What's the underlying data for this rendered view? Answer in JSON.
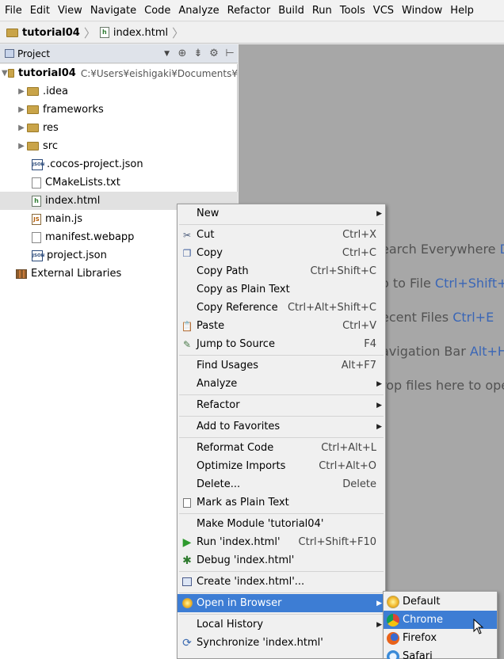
{
  "menubar": {
    "items": [
      "File",
      "Edit",
      "View",
      "Navigate",
      "Code",
      "Analyze",
      "Refactor",
      "Build",
      "Run",
      "Tools",
      "VCS",
      "Window",
      "Help"
    ]
  },
  "navbar": {
    "project": "tutorial04",
    "file": "index.html"
  },
  "project_panel": {
    "title": "Project"
  },
  "tree": {
    "root": {
      "name": "tutorial04",
      "path": "C:¥Users¥eishigaki¥Documents¥"
    },
    "items": [
      {
        "name": ".idea",
        "type": "folder"
      },
      {
        "name": "frameworks",
        "type": "folder"
      },
      {
        "name": "res",
        "type": "folder"
      },
      {
        "name": "src",
        "type": "folder"
      },
      {
        "name": ".cocos-project.json",
        "type": "json"
      },
      {
        "name": "CMakeLists.txt",
        "type": "txt"
      },
      {
        "name": "index.html",
        "type": "html"
      },
      {
        "name": "main.js",
        "type": "js"
      },
      {
        "name": "manifest.webapp",
        "type": "txt"
      },
      {
        "name": "project.json",
        "type": "json"
      }
    ],
    "external": "External Libraries"
  },
  "editor_hints": [
    {
      "text": "earch Everywhere ",
      "key": "D"
    },
    {
      "text": "o to File ",
      "key": "Ctrl+Shift+"
    },
    {
      "text": "ecent Files ",
      "key": "Ctrl+E"
    },
    {
      "text": "avigation Bar ",
      "key": "Alt+H"
    },
    {
      "text": "rop files here to ope",
      "key": ""
    }
  ],
  "context_menu": {
    "new": "New",
    "cut": {
      "label": "Cut",
      "shortcut": "Ctrl+X"
    },
    "copy": {
      "label": "Copy",
      "shortcut": "Ctrl+C"
    },
    "copy_path": {
      "label": "Copy Path",
      "shortcut": "Ctrl+Shift+C"
    },
    "copy_plain": {
      "label": "Copy as Plain Text",
      "shortcut": ""
    },
    "copy_ref": {
      "label": "Copy Reference",
      "shortcut": "Ctrl+Alt+Shift+C"
    },
    "paste": {
      "label": "Paste",
      "shortcut": "Ctrl+V"
    },
    "jump": {
      "label": "Jump to Source",
      "shortcut": "F4"
    },
    "find_usages": {
      "label": "Find Usages",
      "shortcut": "Alt+F7"
    },
    "analyze": "Analyze",
    "refactor": "Refactor",
    "add_favorites": "Add to Favorites",
    "reformat": {
      "label": "Reformat Code",
      "shortcut": "Ctrl+Alt+L"
    },
    "optimize": {
      "label": "Optimize Imports",
      "shortcut": "Ctrl+Alt+O"
    },
    "delete": {
      "label": "Delete...",
      "shortcut": "Delete"
    },
    "mark_plain": "Mark as Plain Text",
    "make_module": "Make Module 'tutorial04'",
    "run": {
      "label": "Run 'index.html'",
      "shortcut": "Ctrl+Shift+F10"
    },
    "debug": "Debug 'index.html'",
    "create": "Create 'index.html'...",
    "open_browser": "Open in Browser",
    "local_history": "Local History",
    "synchronize": "Synchronize 'index.html'"
  },
  "browser_submenu": [
    "Default",
    "Chrome",
    "Firefox",
    "Safari"
  ],
  "colors": {
    "highlight": "#3d7dd4",
    "editor_bg": "#a7a7a7",
    "hint_key": "#3a66b6"
  }
}
